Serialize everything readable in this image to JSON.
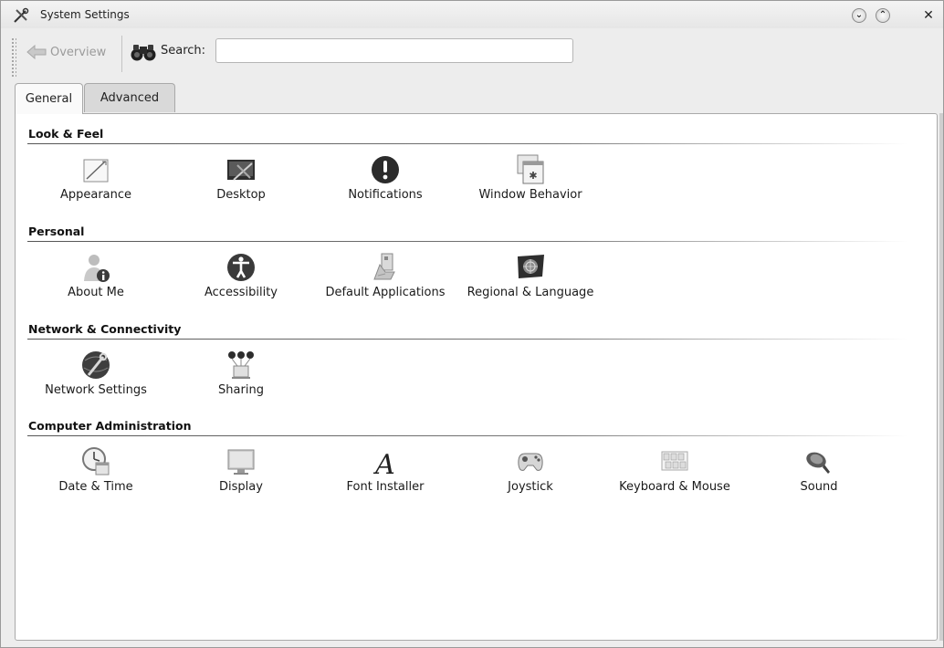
{
  "window": {
    "title": "System Settings",
    "controls": {
      "minimize": "⌄",
      "maximize": "⌃",
      "close": "✕"
    }
  },
  "toolbar": {
    "back_label": "Overview",
    "search_label": "Search:",
    "search_value": "",
    "search_placeholder": ""
  },
  "tabs": [
    {
      "label": "General",
      "selected": true
    },
    {
      "label": "Advanced",
      "selected": false
    }
  ],
  "sections": [
    {
      "title": "Look & Feel",
      "items": [
        {
          "label": "Appearance",
          "icon": "appearance-icon"
        },
        {
          "label": "Desktop",
          "icon": "desktop-icon"
        },
        {
          "label": "Notifications",
          "icon": "notifications-icon"
        },
        {
          "label": "Window Behavior",
          "icon": "window-behavior-icon"
        }
      ]
    },
    {
      "title": "Personal",
      "items": [
        {
          "label": "About Me",
          "icon": "about-me-icon"
        },
        {
          "label": "Accessibility",
          "icon": "accessibility-icon"
        },
        {
          "label": "Default Applications",
          "icon": "default-applications-icon"
        },
        {
          "label": "Regional & Language",
          "icon": "regional-language-icon"
        }
      ]
    },
    {
      "title": "Network & Connectivity",
      "items": [
        {
          "label": "Network Settings",
          "icon": "network-settings-icon"
        },
        {
          "label": "Sharing",
          "icon": "sharing-icon"
        }
      ]
    },
    {
      "title": "Computer Administration",
      "items": [
        {
          "label": "Date & Time",
          "icon": "date-time-icon"
        },
        {
          "label": "Display",
          "icon": "display-icon"
        },
        {
          "label": "Font Installer",
          "icon": "font-installer-icon"
        },
        {
          "label": "Joystick",
          "icon": "joystick-icon"
        },
        {
          "label": "Keyboard & Mouse",
          "icon": "keyboard-mouse-icon"
        },
        {
          "label": "Sound",
          "icon": "sound-icon"
        }
      ]
    }
  ]
}
